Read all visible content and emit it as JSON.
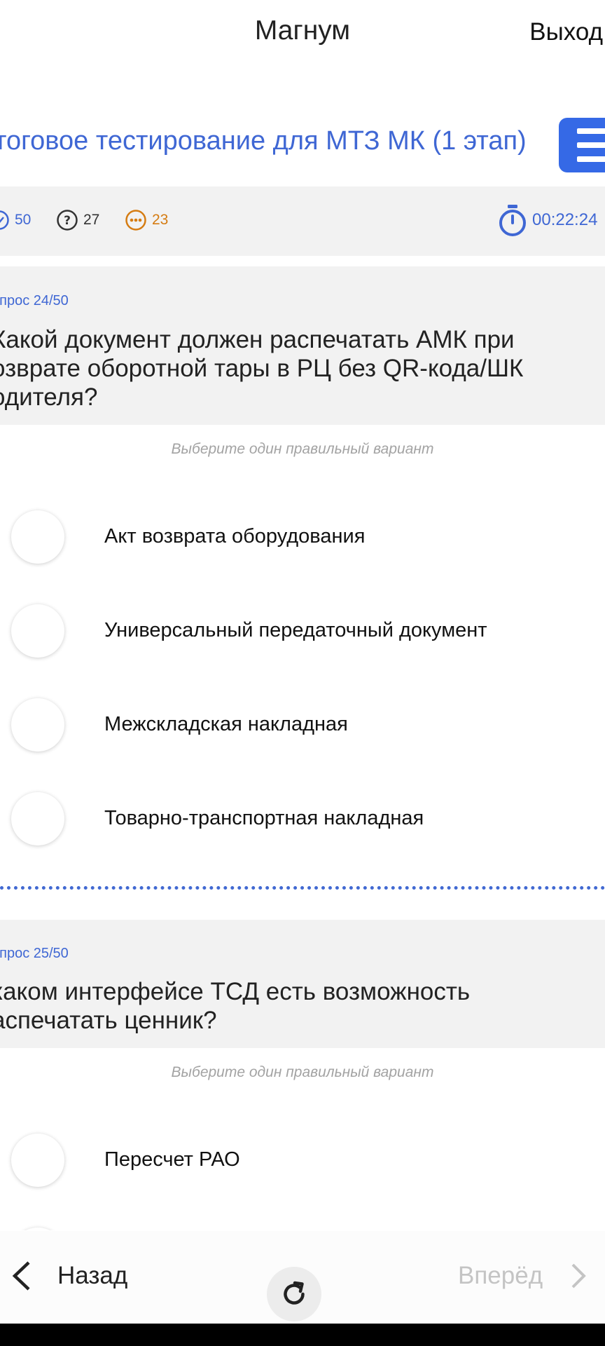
{
  "header": {
    "app_title": "Магнум",
    "exit_label": "Выход"
  },
  "test": {
    "title": "тоговое тестирование для МТЗ МК (1 этап)"
  },
  "stats": {
    "total": "50",
    "answered": "27",
    "remaining": "23",
    "timer": "00:22:24"
  },
  "questions": [
    {
      "number": "опрос 24/50",
      "text": "Какой документ должен распечатать АМК при озврате оборотной тары в РЦ без QR-кода/ШК одителя?",
      "hint": "Выберите один правильный вариант",
      "options": [
        "Акт возврата оборудования",
        "Универсальный передаточный документ",
        "Межскладская накладная",
        "Товарно-транспортная накладная"
      ]
    },
    {
      "number": "опрос 25/50",
      "text": " каком интерфейсе ТСД есть возможность аспечатать ценник?",
      "hint": "Выберите один правильный вариант",
      "options": [
        "Пересчет РАО"
      ]
    }
  ],
  "nav": {
    "back_label": "Назад",
    "forward_label": "Вперёд"
  },
  "colors": {
    "accent": "#3f67d4",
    "menu_button": "#3569e6",
    "remaining": "#d57c12",
    "panel": "#f2f2f2"
  },
  "icons": [
    "menu-icon",
    "check-circle-icon",
    "question-circle-icon",
    "dots-circle-icon",
    "stopwatch-icon",
    "chevron-left-icon",
    "refresh-icon",
    "chevron-right-icon"
  ]
}
